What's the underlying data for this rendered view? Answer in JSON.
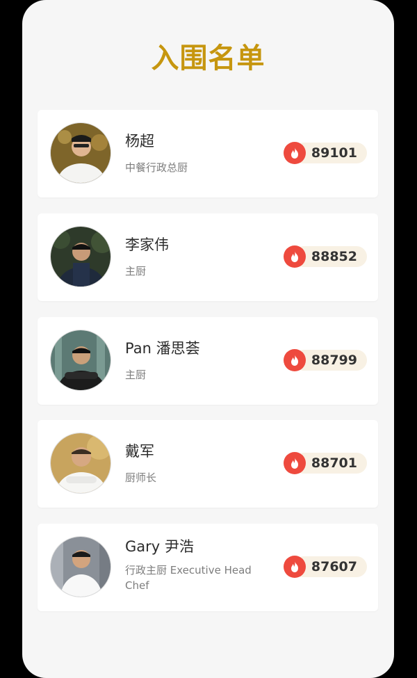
{
  "header": {
    "title": "入围名单"
  },
  "colors": {
    "title": "#c6960f",
    "vote_icon_bg": "#ee4a3e",
    "vote_pill_bg": "#f8f1e4"
  },
  "candidates": [
    {
      "name": "杨超",
      "role": "中餐行政总厨",
      "votes": "89101",
      "avatar_icon": "chef-portrait-icon"
    },
    {
      "name": "李家伟",
      "role": "主厨",
      "votes": "88852",
      "avatar_icon": "chef-portrait-icon"
    },
    {
      "name": "Pan 潘思荟",
      "role": "主厨",
      "votes": "88799",
      "avatar_icon": "chef-portrait-icon"
    },
    {
      "name": "戴军",
      "role": "厨师长",
      "votes": "88701",
      "avatar_icon": "chef-portrait-icon"
    },
    {
      "name": "Gary 尹浩",
      "role": "行政主厨 Executive Head Chef",
      "votes": "87607",
      "avatar_icon": "chef-portrait-icon"
    }
  ]
}
